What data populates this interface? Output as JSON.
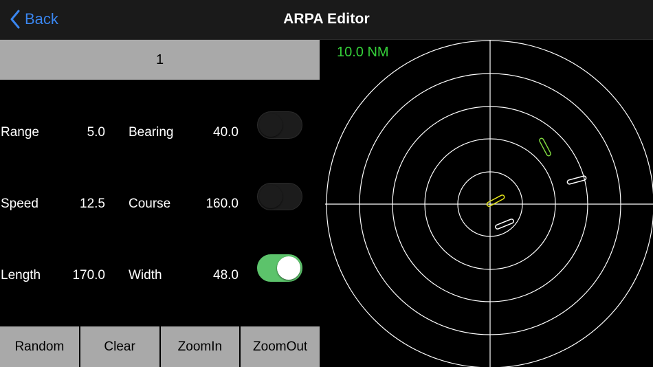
{
  "nav": {
    "back_label": "Back",
    "title": "ARPA Editor"
  },
  "target_selector": {
    "value": "1"
  },
  "fields": [
    {
      "label1": "Range",
      "value1": "5.0",
      "label2": "Bearing",
      "value2": "40.0",
      "toggle_on": false
    },
    {
      "label1": "Speed",
      "value1": "12.5",
      "label2": "Course",
      "value2": "160.0",
      "toggle_on": false
    },
    {
      "label1": "Length",
      "value1": "170.0",
      "label2": "Width",
      "value2": "48.0",
      "toggle_on": true
    }
  ],
  "buttons": {
    "random": "Random",
    "clear": "Clear",
    "zoom_in": "ZoomIn",
    "zoom_out": "ZoomOut"
  },
  "radar": {
    "range_label": "10.0 NM",
    "colors": {
      "range_label": "#35d13a",
      "rings": "#ffffff",
      "own_ship": "#e8e81a",
      "selected_target": "#7ed63e",
      "target": "#ffffff"
    }
  }
}
